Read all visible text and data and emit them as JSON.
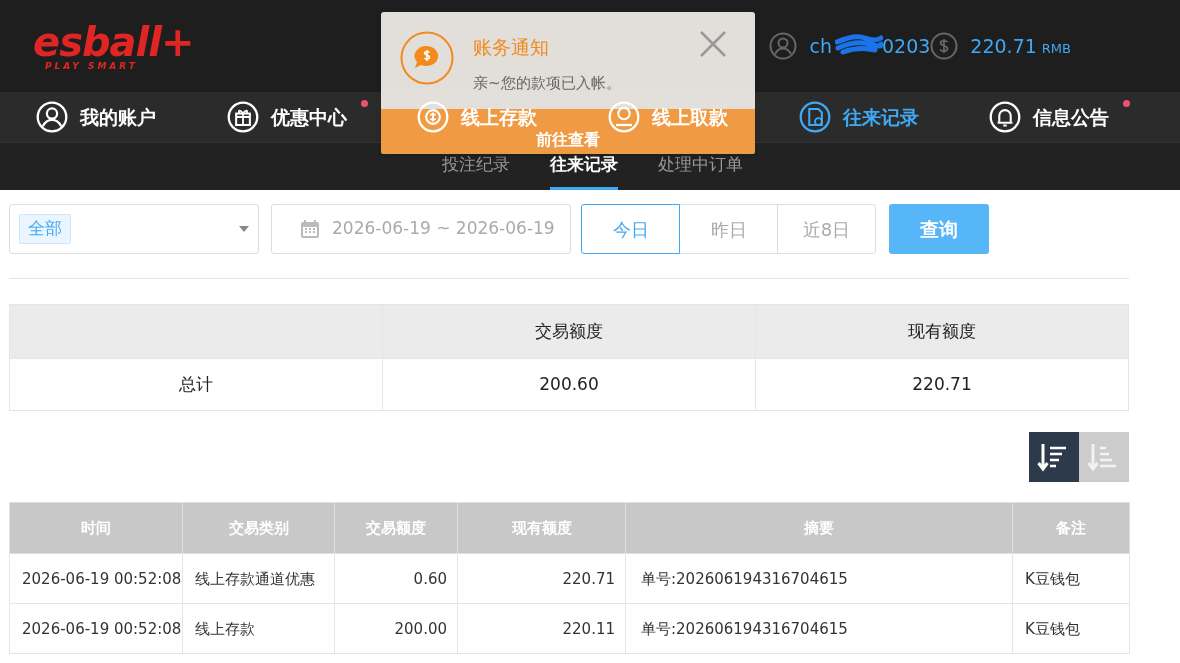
{
  "header": {
    "logo": "esball+",
    "tagline": "PLAY SMART",
    "username_start": "ch",
    "username_end": "0203",
    "balance": "220.71",
    "currency": "RMB"
  },
  "nav": [
    {
      "label": "我的账户",
      "kind": "user",
      "selected": false,
      "dot": false
    },
    {
      "label": "优惠中心",
      "kind": "gift",
      "selected": false,
      "dot": true
    },
    {
      "label": "线上存款",
      "kind": "deposit",
      "selected": false,
      "dot": false
    },
    {
      "label": "线上取款",
      "kind": "withdraw",
      "selected": false,
      "dot": false
    },
    {
      "label": "往来记录",
      "kind": "record",
      "selected": true,
      "dot": false
    },
    {
      "label": "信息公告",
      "kind": "bell",
      "selected": false,
      "dot": true
    }
  ],
  "notification": {
    "title": "账务通知",
    "message": "亲~您的款项已入帐。",
    "action": "前往查看"
  },
  "subtabs": [
    {
      "label": "投注纪录",
      "selected": false
    },
    {
      "label": "往来记录",
      "selected": true
    },
    {
      "label": "处理中订单",
      "selected": false
    }
  ],
  "filter": {
    "type_tag": "全部",
    "date_range": "2026-06-19 ~ 2026-06-19",
    "ranges": [
      {
        "label": "今日",
        "selected": true
      },
      {
        "label": "昨日",
        "selected": false
      },
      {
        "label": "近8日",
        "selected": false
      }
    ],
    "query": "查询"
  },
  "summary": {
    "columns": [
      "",
      "交易额度",
      "现有额度"
    ],
    "rows": [
      [
        "总计",
        "200.60",
        "220.71"
      ]
    ]
  },
  "sort": [
    {
      "kind": "desc",
      "selected": true
    },
    {
      "kind": "asc",
      "selected": false
    }
  ],
  "table": {
    "columns": [
      "时间",
      "交易类别",
      "交易额度",
      "现有额度",
      "摘要",
      "备注"
    ],
    "rows": [
      [
        "2026-06-19 00:52:08",
        "线上存款通道优惠",
        "0.60",
        "220.71",
        "单号:202606194316704615",
        "K豆钱包"
      ],
      [
        "2026-06-19 00:52:08",
        "线上存款",
        "200.00",
        "220.11",
        "单号:202606194316704615",
        "K豆钱包"
      ]
    ]
  }
}
